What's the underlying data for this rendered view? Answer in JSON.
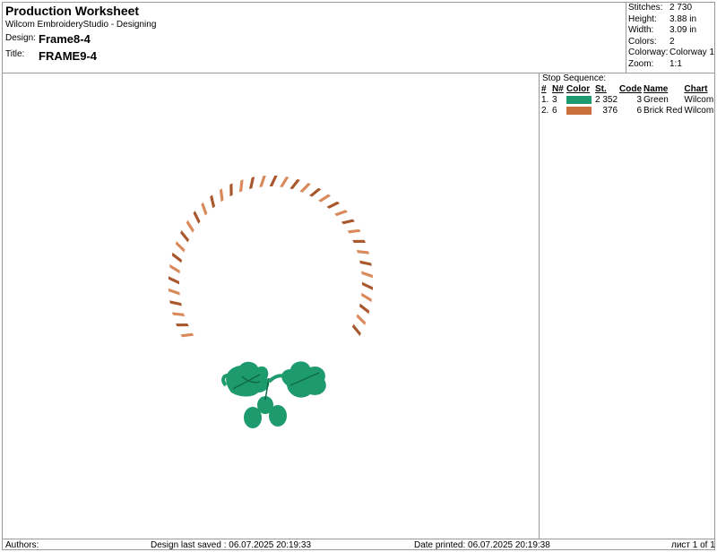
{
  "header": {
    "title": "Production Worksheet",
    "software": "Wilcom EmbroideryStudio - Designing",
    "design_label": "Design:",
    "design_value": "Frame8-4",
    "title_label": "Title:",
    "title_value": "FRAME9-4"
  },
  "stats": [
    {
      "label": "Stitches:",
      "value": "2 730"
    },
    {
      "label": "Height:",
      "value": "3.88 in"
    },
    {
      "label": "Width:",
      "value": "3.09 in"
    },
    {
      "label": "Colors:",
      "value": "2"
    },
    {
      "label": "Colorway:",
      "value": "Colorway 1"
    },
    {
      "label": "Zoom:",
      "value": "1:1"
    }
  ],
  "stop_sequence": {
    "title": "Stop Sequence:",
    "headers": [
      "#",
      "N#",
      "Color",
      "St.",
      "Code",
      "Name",
      "Chart"
    ],
    "rows": [
      {
        "index": "1.",
        "needle": "3",
        "color": "#1e9b6e",
        "stitches": "2 352",
        "code": "3",
        "name": "Green",
        "chart": "Wilcom"
      },
      {
        "index": "2.",
        "needle": "6",
        "color": "#c8703c",
        "stitches": "376",
        "code": "6",
        "name": "Brick Red",
        "chart": "Wilcom"
      }
    ]
  },
  "colors": {
    "frame_stitch": "#d9895a",
    "frame_stitch_dark": "#a8582c",
    "leaf_green": "#1e9b6e",
    "leaf_dark": "#0f6a47"
  },
  "footer": {
    "authors": "Authors:",
    "last_saved": "Design last saved : 06.07.2025 20:19:33",
    "date_printed": "Date printed: 06.07.2025 20:19:38",
    "page": "лист 1 of 1"
  }
}
